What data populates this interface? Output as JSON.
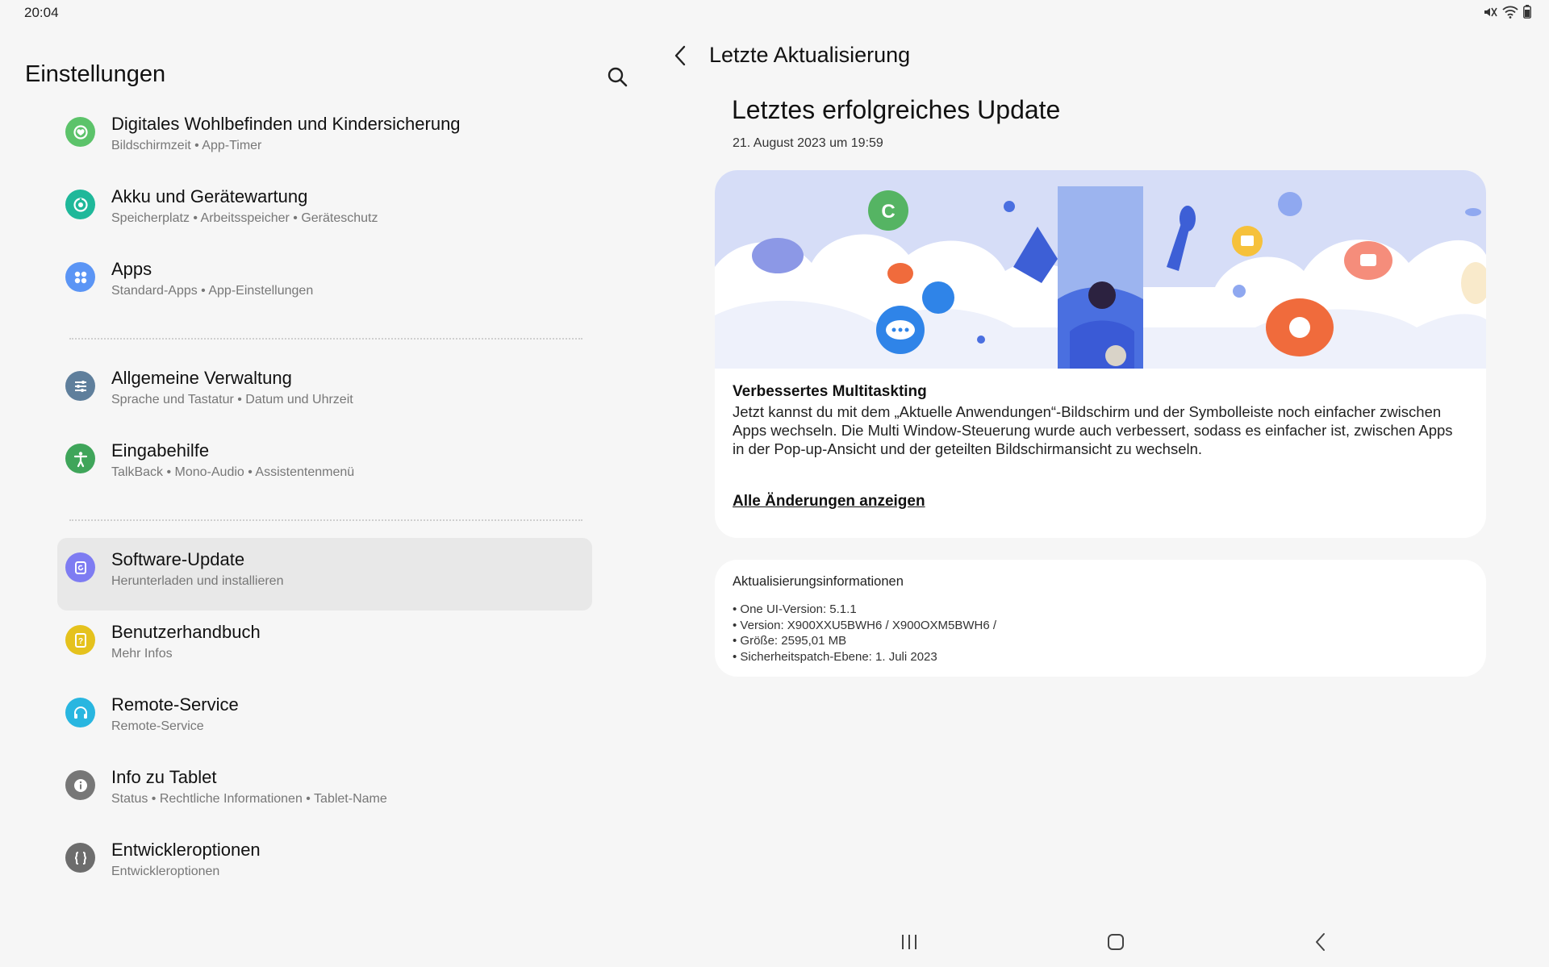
{
  "status_bar": {
    "time": "20:04",
    "icons": [
      "mute-icon",
      "wifi-icon",
      "battery-icon"
    ]
  },
  "settings": {
    "title": "Einstellungen",
    "search_icon": "search-icon",
    "items": [
      {
        "title": "Digitales Wohlbefinden und Kindersicherung",
        "subtitle": "Bildschirmzeit • App-Timer",
        "icon": "wellbeing-icon",
        "color": "#5cc36a"
      },
      {
        "title": "Akku und Gerätewartung",
        "subtitle": "Speicherplatz • Arbeitsspeicher • Geräteschutz",
        "icon": "device-care-icon",
        "color": "#1fb89a"
      },
      {
        "title": "Apps",
        "subtitle": "Standard-Apps • App-Einstellungen",
        "icon": "apps-icon",
        "color": "#5b95f5"
      },
      {
        "title": "Allgemeine Verwaltung",
        "subtitle": "Sprache und Tastatur • Datum und Uhrzeit",
        "icon": "sliders-icon",
        "color": "#5f7f9c"
      },
      {
        "title": "Eingabehilfe",
        "subtitle": "TalkBack • Mono-Audio • Assistentenmenü",
        "icon": "accessibility-icon",
        "color": "#3fa55a"
      },
      {
        "title": "Software-Update",
        "subtitle": "Herunterladen und installieren",
        "icon": "software-update-icon",
        "color": "#7e7cf2"
      },
      {
        "title": "Benutzerhandbuch",
        "subtitle": "Mehr Infos",
        "icon": "user-manual-icon",
        "color": "#e5c21d"
      },
      {
        "title": "Remote-Service",
        "subtitle": "Remote-Service",
        "icon": "headset-icon",
        "color": "#29b6e0"
      },
      {
        "title": "Info zu Tablet",
        "subtitle": "Status • Rechtliche Informationen • Tablet-Name",
        "icon": "info-icon",
        "color": "#777777"
      },
      {
        "title": "Entwickleroptionen",
        "subtitle": "Entwickleroptionen",
        "icon": "developer-braces-icon",
        "color": "#6d6d6d"
      }
    ],
    "selected_index": 5
  },
  "detail": {
    "title": "Letzte Aktualisierung",
    "heading": "Letztes erfolgreiches Update",
    "date": "21. August 2023 um 19:59",
    "feature_title": "Verbessertes Multitaskting",
    "feature_desc": "Jetzt kannst du mit dem „Aktuelle Anwendungen“-Bildschirm und der Symbolleiste noch einfacher zwischen Apps wechseln. Die Multi Window-Steuerung wurde auch verbessert, sodass es einfacher ist, zwischen Apps in der Pop-up-Ansicht und der geteilten Bildschirmansicht zu wechseln.",
    "all_changes_link": "Alle Änderungen anzeigen",
    "info_title": "Aktualisierungsinformationen",
    "info_items": [
      "• One UI-Version: 5.1.1",
      "• Version: X900XXU5BWH6 / X900OXM5BWH6 /",
      "• Größe: 2595,01 MB",
      "• Sicherheitspatch-Ebene: 1. Juli 2023"
    ]
  },
  "nav": {
    "recents_icon": "recents-icon",
    "home_icon": "home-icon",
    "back_icon": "back-icon"
  },
  "colors": {
    "background": "#f6f6f6",
    "card": "#ffffff",
    "selected_row": "#e8e8e8",
    "banner_sky": "#d6ddf7",
    "accent_blue": "#4a6fe0",
    "accent_orange": "#f06b3c"
  }
}
